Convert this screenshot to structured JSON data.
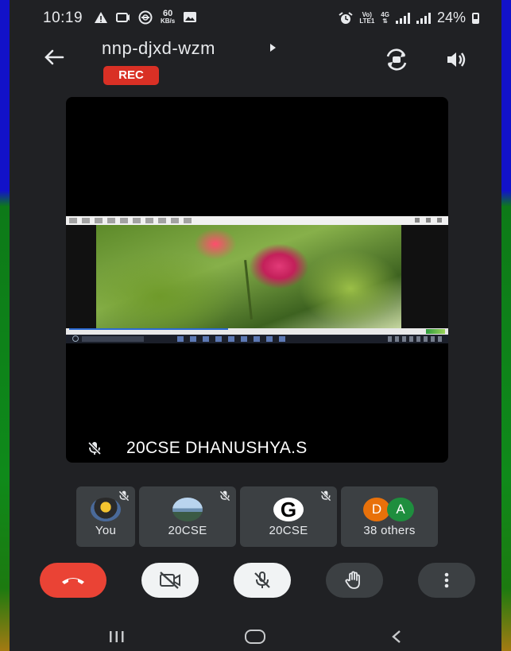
{
  "status_bar": {
    "time": "10:19",
    "net_speed_value": "60",
    "net_speed_unit": "KB/s",
    "sig1_top": "Vo)",
    "sig1_bottom": "LTE1",
    "sig2_top": "4G",
    "battery_percent": "24%",
    "icons": [
      "warning-icon",
      "cast-icon",
      "vpn-icon",
      "image-icon",
      "alarm-icon",
      "signal-icon",
      "battery-icon"
    ]
  },
  "header": {
    "meeting_code": "nnp-djxd-wzm",
    "rec_label": "REC"
  },
  "main_tile": {
    "participant_name": "20CSE DHANUSHYA.S"
  },
  "participants": [
    {
      "name": "You"
    },
    {
      "name": "20CSE"
    },
    {
      "name": "20CSE"
    },
    {
      "name": "38 others",
      "bubbles": [
        {
          "letter": "D",
          "color": "#e8710a"
        },
        {
          "letter": "A",
          "color": "#1e8e3e"
        }
      ]
    }
  ],
  "colors": {
    "end_call": "#ea4335",
    "rec": "#d93025",
    "background": "#202124",
    "tile": "#3c4043"
  }
}
